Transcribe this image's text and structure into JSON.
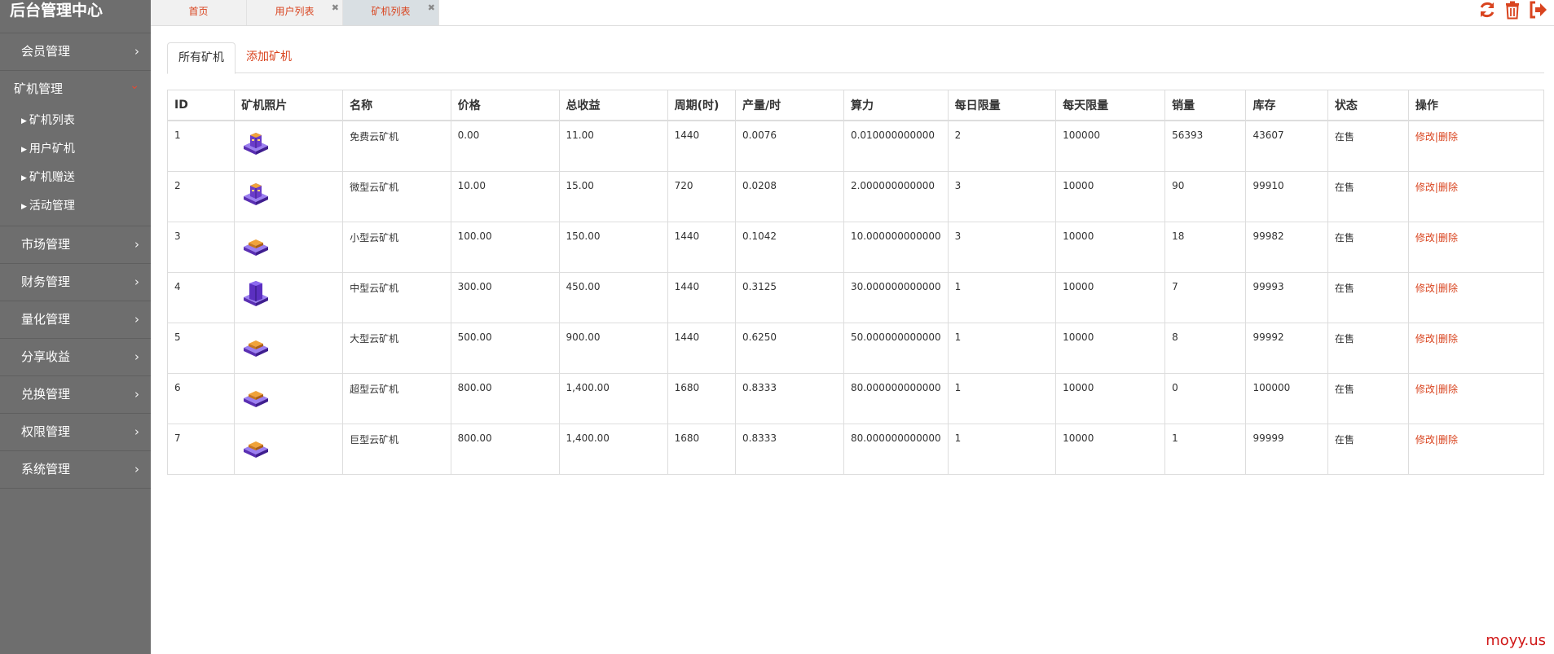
{
  "sidebar": {
    "title": "后台管理中心",
    "items_top": [
      {
        "label": "会员管理"
      }
    ],
    "group": {
      "label": "矿机管理",
      "children": [
        {
          "label": "矿机列表"
        },
        {
          "label": "用户矿机"
        },
        {
          "label": "矿机赠送"
        },
        {
          "label": "活动管理"
        }
      ]
    },
    "items_bottom": [
      {
        "label": "市场管理"
      },
      {
        "label": "财务管理"
      },
      {
        "label": "量化管理"
      },
      {
        "label": "分享收益"
      },
      {
        "label": "兑换管理"
      },
      {
        "label": "权限管理"
      },
      {
        "label": "系统管理"
      }
    ]
  },
  "topbar": {
    "tabs": [
      {
        "label": "首页"
      },
      {
        "label": "用户列表"
      },
      {
        "label": "矿机列表"
      }
    ],
    "close_glyph": "✖",
    "tool_icons": [
      "refresh-icon",
      "trash-icon",
      "logout-icon"
    ],
    "accent": "#d9441f"
  },
  "page": {
    "tab_all": "所有矿机",
    "tab_add": "添加矿机"
  },
  "table": {
    "headers": [
      "ID",
      "矿机照片",
      "名称",
      "价格",
      "总收益",
      "周期(时)",
      "产量/时",
      "算力",
      "每日限量",
      "每天限量",
      "销量",
      "库存",
      "状态",
      "操作"
    ],
    "edit_label": "修改",
    "sep": "|",
    "delete_label": "删除",
    "rows": [
      {
        "id": "1",
        "name": "免费云矿机",
        "price": "0.00",
        "total": "11.00",
        "cycle": "1440",
        "output": "0.0076",
        "power": "0.010000000000",
        "daily": "2",
        "day_limit": "100000",
        "sales": "56393",
        "stock": "43607",
        "status": "在售",
        "img": "tower"
      },
      {
        "id": "2",
        "name": "微型云矿机",
        "price": "10.00",
        "total": "15.00",
        "cycle": "720",
        "output": "0.0208",
        "power": "2.000000000000",
        "daily": "3",
        "day_limit": "10000",
        "sales": "90",
        "stock": "99910",
        "status": "在售",
        "img": "tower"
      },
      {
        "id": "3",
        "name": "小型云矿机",
        "price": "100.00",
        "total": "150.00",
        "cycle": "1440",
        "output": "0.1042",
        "power": "10.000000000000",
        "daily": "3",
        "day_limit": "10000",
        "sales": "18",
        "stock": "99982",
        "status": "在售",
        "img": "flat"
      },
      {
        "id": "4",
        "name": "中型云矿机",
        "price": "300.00",
        "total": "450.00",
        "cycle": "1440",
        "output": "0.3125",
        "power": "30.000000000000",
        "daily": "1",
        "day_limit": "10000",
        "sales": "7",
        "stock": "99993",
        "status": "在售",
        "img": "tall"
      },
      {
        "id": "5",
        "name": "大型云矿机",
        "price": "500.00",
        "total": "900.00",
        "cycle": "1440",
        "output": "0.6250",
        "power": "50.000000000000",
        "daily": "1",
        "day_limit": "10000",
        "sales": "8",
        "stock": "99992",
        "status": "在售",
        "img": "flat"
      },
      {
        "id": "6",
        "name": "超型云矿机",
        "price": "800.00",
        "total": "1,400.00",
        "cycle": "1680",
        "output": "0.8333",
        "power": "80.000000000000",
        "daily": "1",
        "day_limit": "10000",
        "sales": "0",
        "stock": "100000",
        "status": "在售",
        "img": "flat"
      },
      {
        "id": "7",
        "name": "巨型云矿机",
        "price": "800.00",
        "total": "1,400.00",
        "cycle": "1680",
        "output": "0.8333",
        "power": "80.000000000000",
        "daily": "1",
        "day_limit": "10000",
        "sales": "1",
        "stock": "99999",
        "status": "在售",
        "img": "flat"
      }
    ]
  },
  "watermark": "moyy.us"
}
